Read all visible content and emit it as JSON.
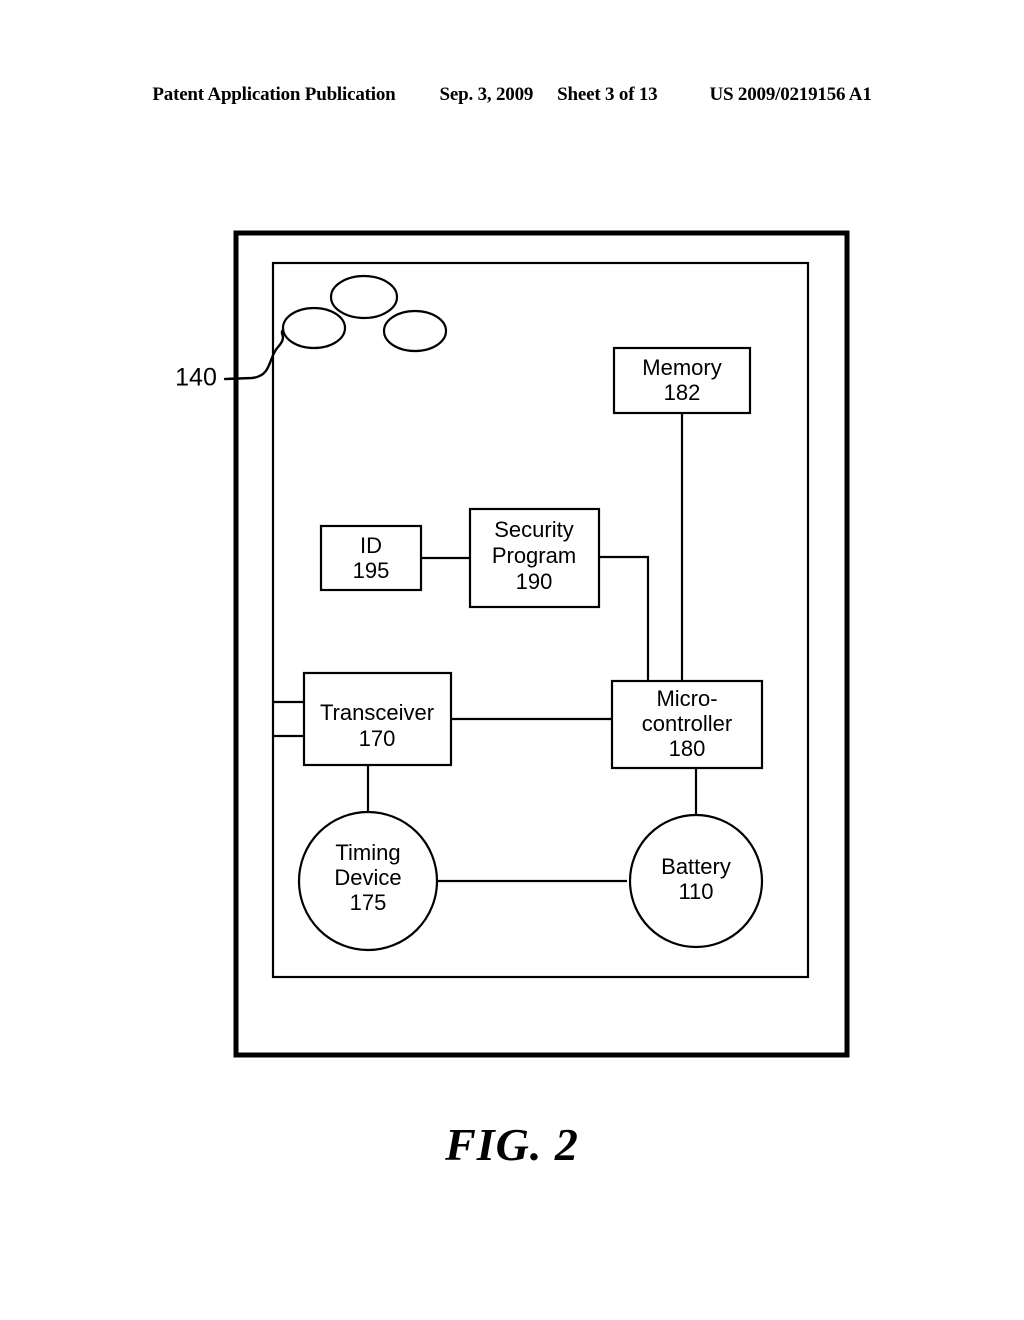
{
  "header": {
    "publication": "Patent Application Publication",
    "date": "Sep. 3, 2009",
    "sheet": "Sheet 3 of 13",
    "patent_number": "US 2009/0219156 A1"
  },
  "figure": {
    "caption": "FIG. 2",
    "callout": {
      "reference": "140"
    },
    "nodes": {
      "memory": {
        "title": "Memory",
        "ref": "182"
      },
      "id": {
        "title": "ID",
        "ref": "195"
      },
      "security_program": {
        "title_line1": "Security",
        "title_line2": "Program",
        "ref": "190"
      },
      "transceiver": {
        "title": "Transceiver",
        "ref": "170"
      },
      "microcontroller": {
        "title_line1": "Micro-",
        "title_line2": "controller",
        "ref": "180"
      },
      "timing_device": {
        "title_line1": "Timing",
        "title_line2": "Device",
        "ref": "175"
      },
      "battery": {
        "title": "Battery",
        "ref": "110"
      }
    }
  }
}
